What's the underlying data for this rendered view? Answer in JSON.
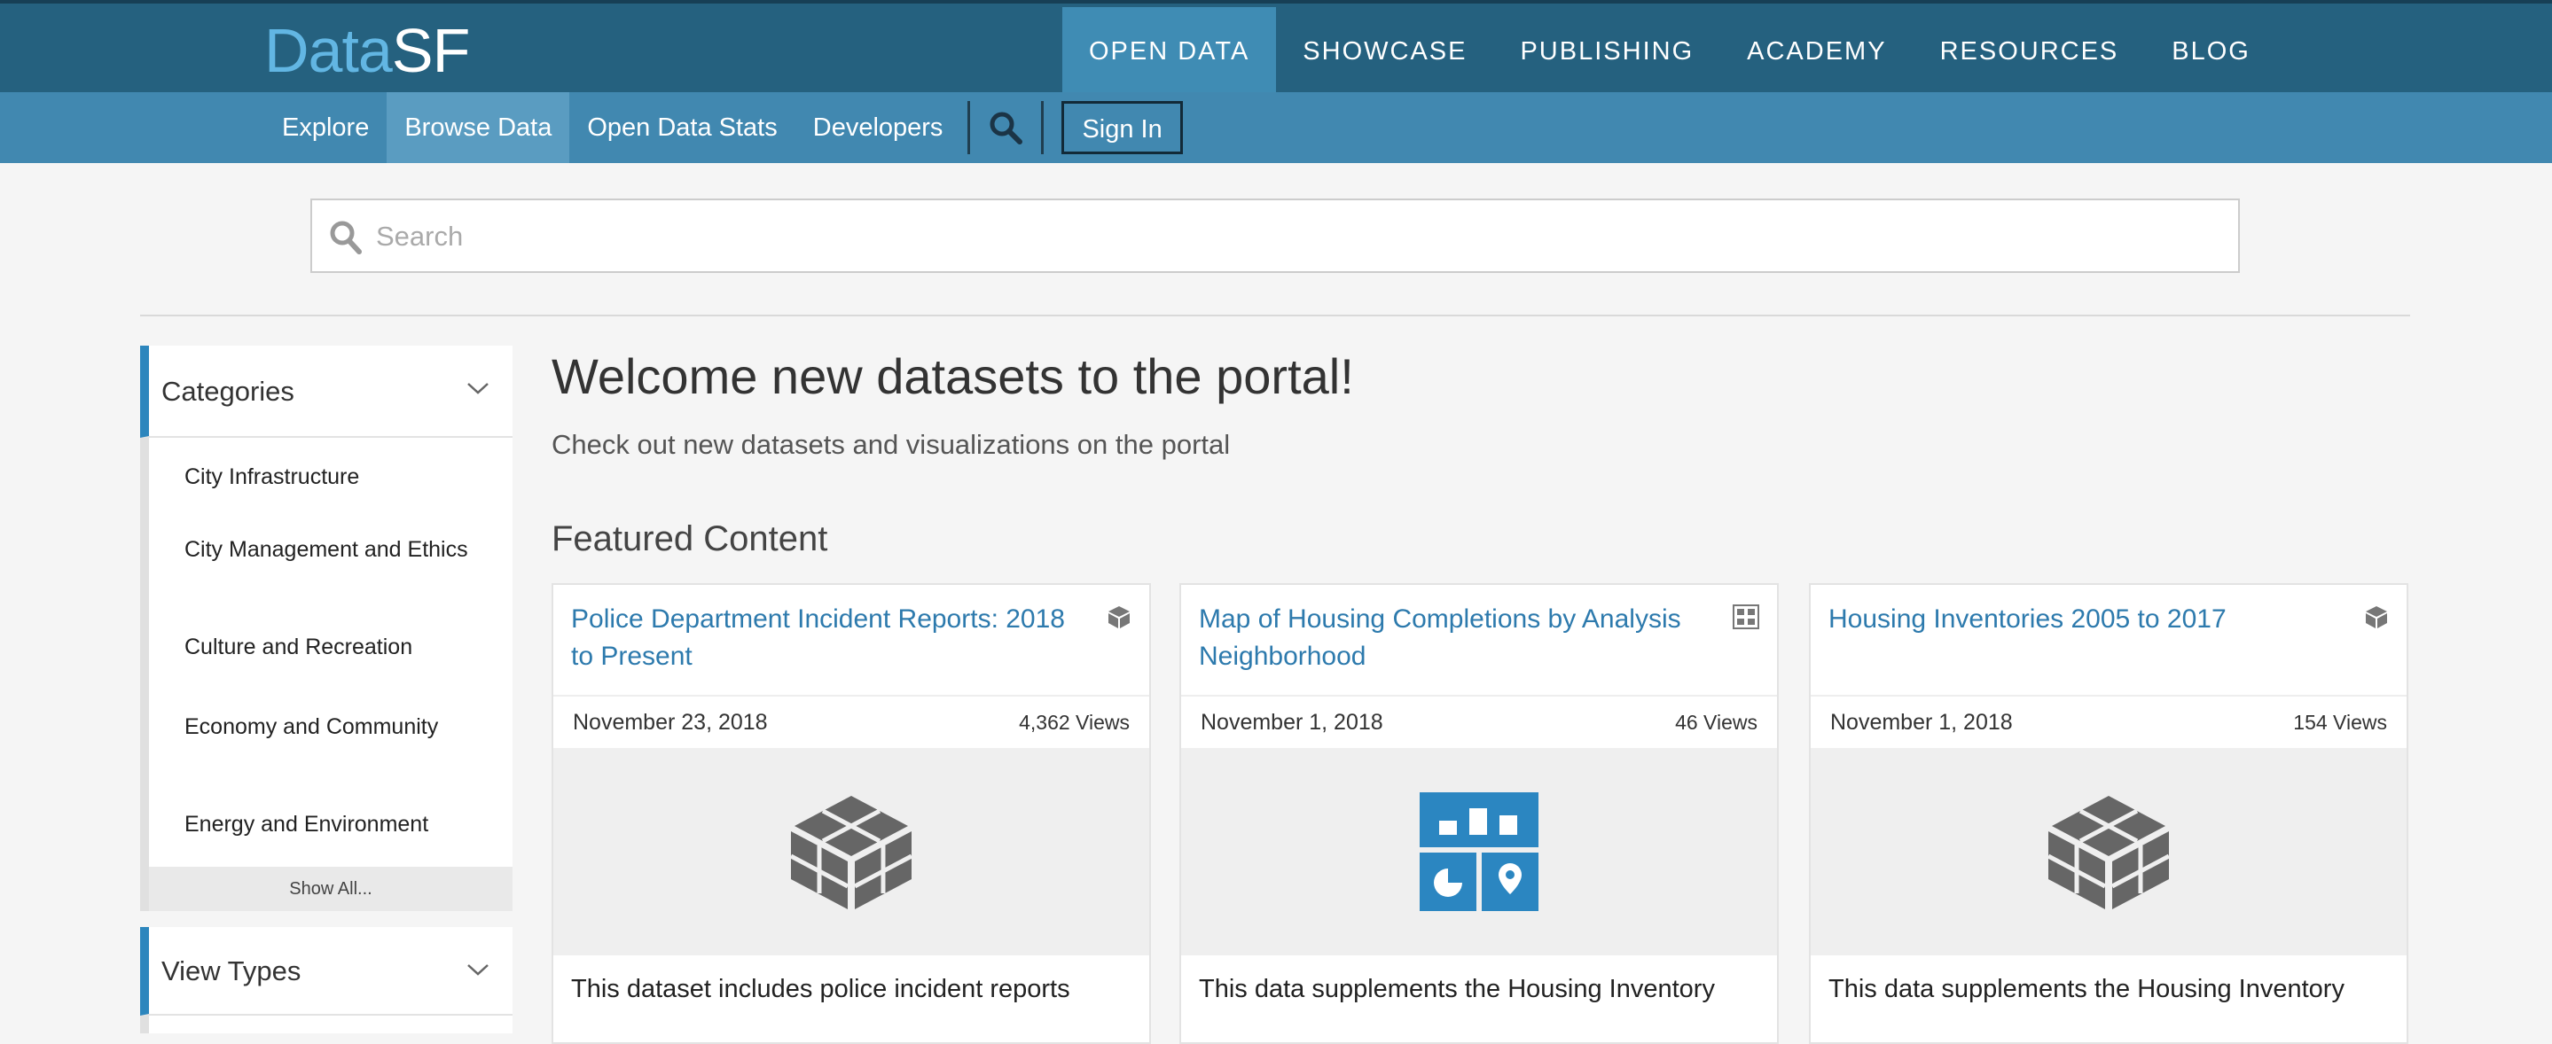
{
  "logo": {
    "part1": "Data",
    "part2": "SF"
  },
  "main_nav": [
    "OPEN DATA",
    "SHOWCASE",
    "PUBLISHING",
    "ACADEMY",
    "RESOURCES",
    "BLOG"
  ],
  "sub_nav": [
    "Explore",
    "Browse Data",
    "Open Data Stats",
    "Developers"
  ],
  "sign_in": "Sign In",
  "search": {
    "placeholder": "Search"
  },
  "sidebar": {
    "categories_title": "Categories",
    "categories": [
      "City Infrastructure",
      "City Management and Ethics",
      "Culture and Recreation",
      "Economy and Community",
      "Energy and Environment"
    ],
    "show_all": "Show All...",
    "view_types_title": "View Types"
  },
  "main": {
    "welcome": "Welcome new datasets to the portal!",
    "subtitle": "Check out new datasets and visualizations on the portal",
    "featured_title": "Featured Content",
    "cards": [
      {
        "title": "Police Department Incident Reports: 2018 to Present",
        "date": "November 23, 2018",
        "views": "4,362 Views",
        "description": "This dataset includes police incident reports",
        "type_icon": "dataset-icon"
      },
      {
        "title": "Map of Housing Completions by Analysis Neighborhood",
        "date": "November 1, 2018",
        "views": "46 Views",
        "description": "This data supplements the Housing Inventory",
        "type_icon": "visualization-icon"
      },
      {
        "title": "Housing Inventories 2005 to 2017",
        "date": "November 1, 2018",
        "views": "154 Views",
        "description": "This data supplements the Housing Inventory",
        "type_icon": "dataset-icon"
      }
    ]
  },
  "colors": {
    "nav_dark": "#25617f",
    "nav_light": "#4188b0",
    "accent": "#2d86bd",
    "link": "#2d7aad",
    "viz_tile": "#2b86c1"
  }
}
